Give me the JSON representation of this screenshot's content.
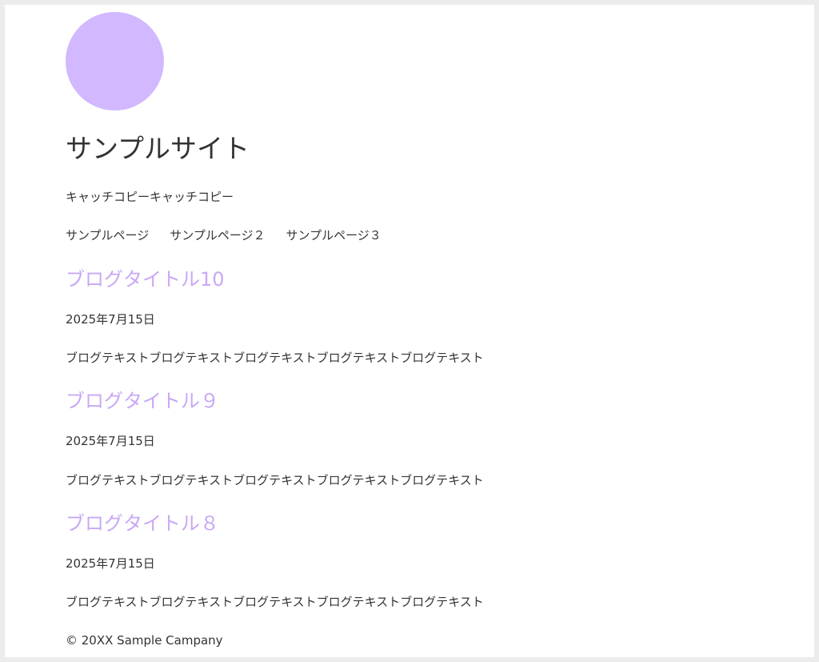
{
  "site": {
    "title": "サンプルサイト",
    "tagline": "キャッチコピーキャッチコピー",
    "logo_color": "#d1b8ff"
  },
  "nav": {
    "items": [
      {
        "label": "サンプルページ"
      },
      {
        "label": "サンプルページ２"
      },
      {
        "label": "サンプルページ３"
      }
    ]
  },
  "posts": [
    {
      "title": "ブログタイトル10",
      "date": "2025年7月15日",
      "text": "ブログテキストブログテキストブログテキストブログテキストブログテキスト"
    },
    {
      "title": "ブログタイトル９",
      "date": "2025年7月15日",
      "text": "ブログテキストブログテキストブログテキストブログテキストブログテキスト"
    },
    {
      "title": "ブログタイトル８",
      "date": "2025年7月15日",
      "text": "ブログテキストブログテキストブログテキストブログテキストブログテキスト"
    }
  ],
  "footer": {
    "copyright": "© 20XX Sample Campany"
  },
  "colors": {
    "accent": "#c8a8f5",
    "text": "#333333",
    "page_background": "#ffffff",
    "outer_background": "#ececec"
  }
}
